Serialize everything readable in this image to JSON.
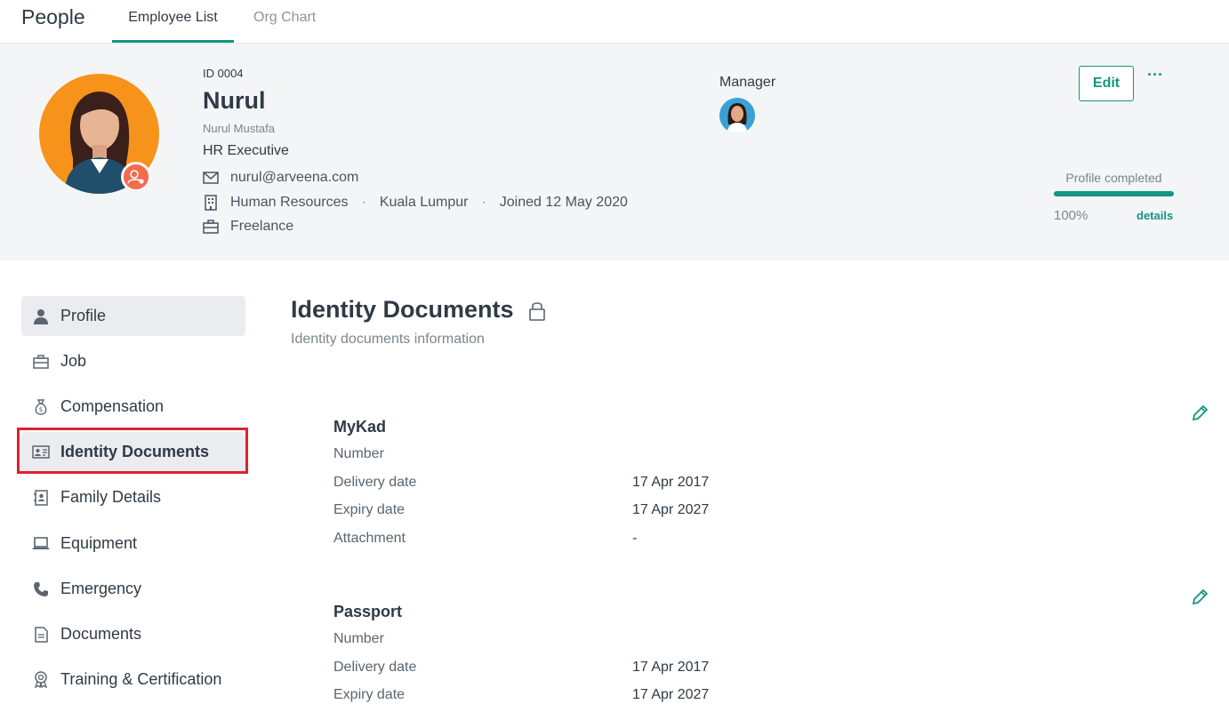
{
  "app": {
    "title": "People"
  },
  "tabs": [
    {
      "label": "Employee List",
      "active": true
    },
    {
      "label": "Org Chart",
      "active": false
    }
  ],
  "employee": {
    "id": "ID 0004",
    "name": "Nurul",
    "full_name": "Nurul Mustafa",
    "title": "HR Executive",
    "email": "nurul@arveena.com",
    "department": "Human Resources",
    "location": "Kuala Lumpur",
    "joined": "Joined 12 May 2020",
    "employment_type": "Freelance",
    "separator": "·"
  },
  "manager": {
    "label": "Manager"
  },
  "actions": {
    "edit_label": "Edit",
    "more_label": "···"
  },
  "profile_progress": {
    "label": "Profile completed",
    "value": "100%",
    "fraction": 1.0,
    "details_label": "details"
  },
  "sidebar": {
    "items": [
      {
        "label": "Profile",
        "icon": "person-icon"
      },
      {
        "label": "Job",
        "icon": "briefcase-icon"
      },
      {
        "label": "Compensation",
        "icon": "money-bag-icon"
      },
      {
        "label": "Identity Documents",
        "icon": "id-card-icon"
      },
      {
        "label": "Family Details",
        "icon": "contact-book-icon"
      },
      {
        "label": "Equipment",
        "icon": "laptop-icon"
      },
      {
        "label": "Emergency",
        "icon": "phone-icon"
      },
      {
        "label": "Documents",
        "icon": "document-icon"
      },
      {
        "label": "Training & Certification",
        "icon": "award-icon"
      }
    ]
  },
  "main": {
    "title": "Identity Documents",
    "subtitle": "Identity documents information",
    "documents": [
      {
        "name": "MyKad",
        "fields": [
          {
            "label": "Number",
            "value": ""
          },
          {
            "label": "Delivery date",
            "value": "17 Apr 2017"
          },
          {
            "label": "Expiry date",
            "value": "17 Apr 2027"
          },
          {
            "label": "Attachment",
            "value": "-"
          }
        ]
      },
      {
        "name": "Passport",
        "fields": [
          {
            "label": "Number",
            "value": ""
          },
          {
            "label": "Delivery date",
            "value": "17 Apr 2017"
          },
          {
            "label": "Expiry date",
            "value": "17 Apr 2027"
          }
        ]
      }
    ]
  },
  "colors": {
    "accent": "#12967f",
    "highlight": "#e0202e",
    "avatar_bg": "#f7931a",
    "badge": "#f26b4d"
  }
}
